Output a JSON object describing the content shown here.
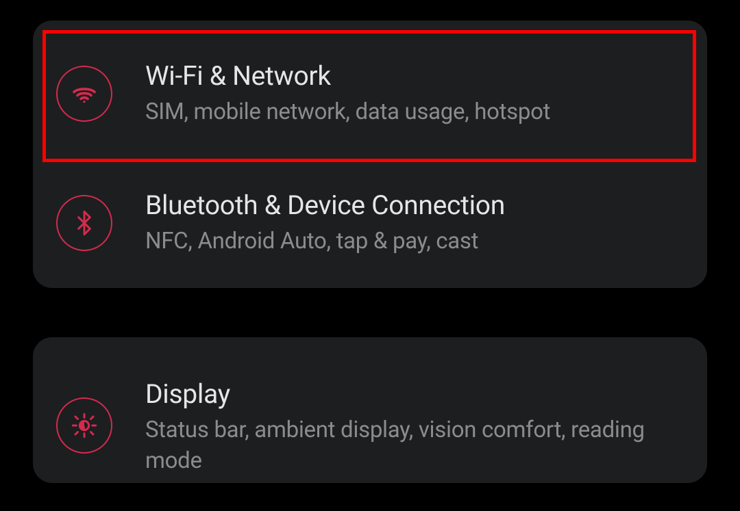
{
  "colors": {
    "accent": "#d32b4d",
    "highlight": "#ff0000",
    "cardBg": "#1d1e20",
    "titleText": "#e6e6e6",
    "subtitleText": "#8c8c8c"
  },
  "settings": {
    "wifi": {
      "title": "Wi-Fi & Network",
      "subtitle": "SIM, mobile network, data usage, hotspot",
      "icon": "wifi-icon",
      "highlighted": true
    },
    "bluetooth": {
      "title": "Bluetooth & Device Connection",
      "subtitle": "NFC, Android Auto, tap & pay, cast",
      "icon": "bluetooth-icon",
      "highlighted": false
    },
    "display": {
      "title": "Display",
      "subtitle": "Status bar, ambient display, vision comfort, reading mode",
      "icon": "brightness-icon",
      "highlighted": false
    }
  }
}
